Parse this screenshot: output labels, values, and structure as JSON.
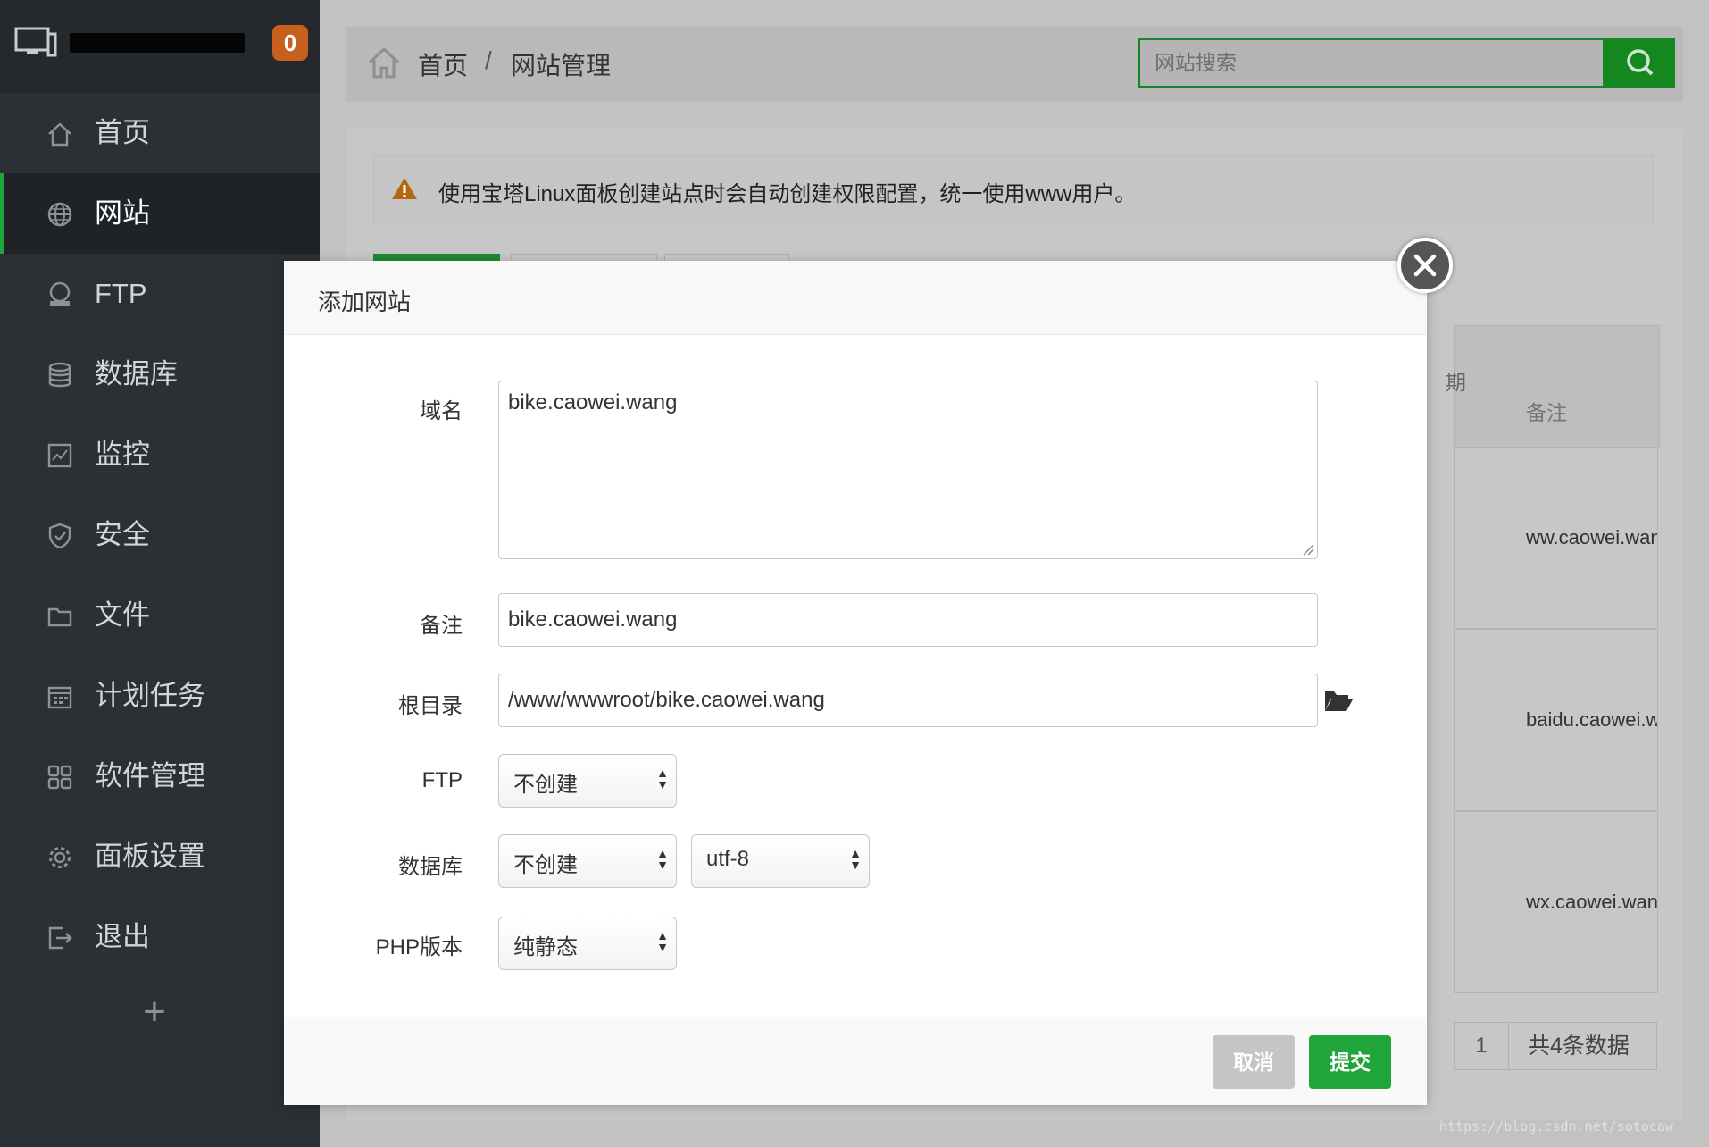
{
  "sidebar": {
    "notification_count": "0",
    "items": [
      {
        "label": "首页",
        "icon": "home-icon"
      },
      {
        "label": "网站",
        "icon": "globe-icon",
        "active": true
      },
      {
        "label": "FTP",
        "icon": "ftp-icon"
      },
      {
        "label": "数据库",
        "icon": "database-icon"
      },
      {
        "label": "监控",
        "icon": "monitor-chart-icon"
      },
      {
        "label": "安全",
        "icon": "shield-icon"
      },
      {
        "label": "文件",
        "icon": "folder-icon"
      },
      {
        "label": "计划任务",
        "icon": "calendar-icon"
      },
      {
        "label": "软件管理",
        "icon": "grid-icon"
      },
      {
        "label": "面板设置",
        "icon": "gear-icon"
      },
      {
        "label": "退出",
        "icon": "logout-icon"
      }
    ],
    "add_label": "+"
  },
  "header": {
    "breadcrumb_home": "首页",
    "breadcrumb_sep": "/",
    "breadcrumb_current": "网站管理",
    "search_placeholder": "网站搜索"
  },
  "panel": {
    "alert_text": "使用宝塔Linux面板创建站点时会自动创建权限配置，统一使用www用户。",
    "table_header_partial": "期",
    "table_header_remark": "备注",
    "rows": [
      "ww.caowei.wang",
      "baidu.caowei.wang",
      "wx.caowei.wang"
    ],
    "pager_page": "1",
    "pager_total": "共4条数据",
    "watermark": "https://blog.csdn.net/sotocaw"
  },
  "modal": {
    "title": "添加网站",
    "domain_label": "域名",
    "domain_value": "bike.caowei.wang",
    "remark_label": "备注",
    "remark_value": "bike.caowei.wang",
    "root_label": "根目录",
    "root_value": "/www/wwwroot/bike.caowei.wang",
    "ftp_label": "FTP",
    "ftp_value": "不创建",
    "db_label": "数据库",
    "db_value": "不创建",
    "db_charset": "utf-8",
    "php_label": "PHP版本",
    "php_value": "纯静态",
    "cancel_label": "取消",
    "submit_label": "提交"
  },
  "colors": {
    "accent": "#20a53a",
    "sidebar_bg": "#2b3035",
    "badge": "#c75f1d"
  }
}
